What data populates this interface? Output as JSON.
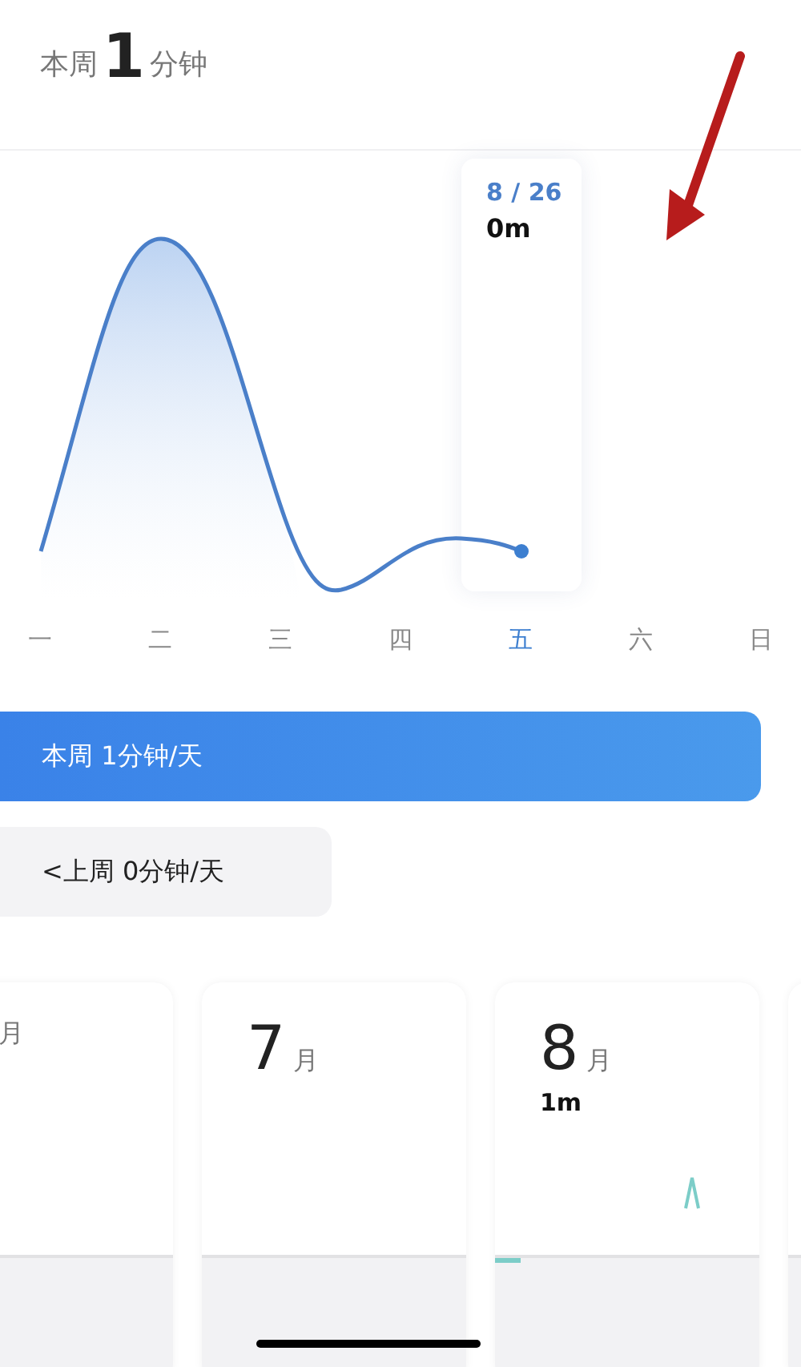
{
  "summary": {
    "prefix": "本周",
    "value": "1",
    "unit": "分钟"
  },
  "tooltip": {
    "date": "8 / 26",
    "value": "0m"
  },
  "weekdays": [
    {
      "label": "一",
      "selected": false
    },
    {
      "label": "二",
      "selected": false
    },
    {
      "label": "三",
      "selected": false
    },
    {
      "label": "四",
      "selected": false
    },
    {
      "label": "五",
      "selected": true
    },
    {
      "label": "六",
      "selected": false
    },
    {
      "label": "日",
      "selected": false
    }
  ],
  "ranges": [
    {
      "label": "本周 1分钟/天",
      "selected": true
    },
    {
      "label": "<上周 0分钟/天",
      "selected": false
    }
  ],
  "month_cards": [
    {
      "unit": "月"
    },
    {
      "number": "7",
      "unit": "月"
    },
    {
      "number": "8",
      "unit": "月",
      "value": "1m"
    }
  ]
}
